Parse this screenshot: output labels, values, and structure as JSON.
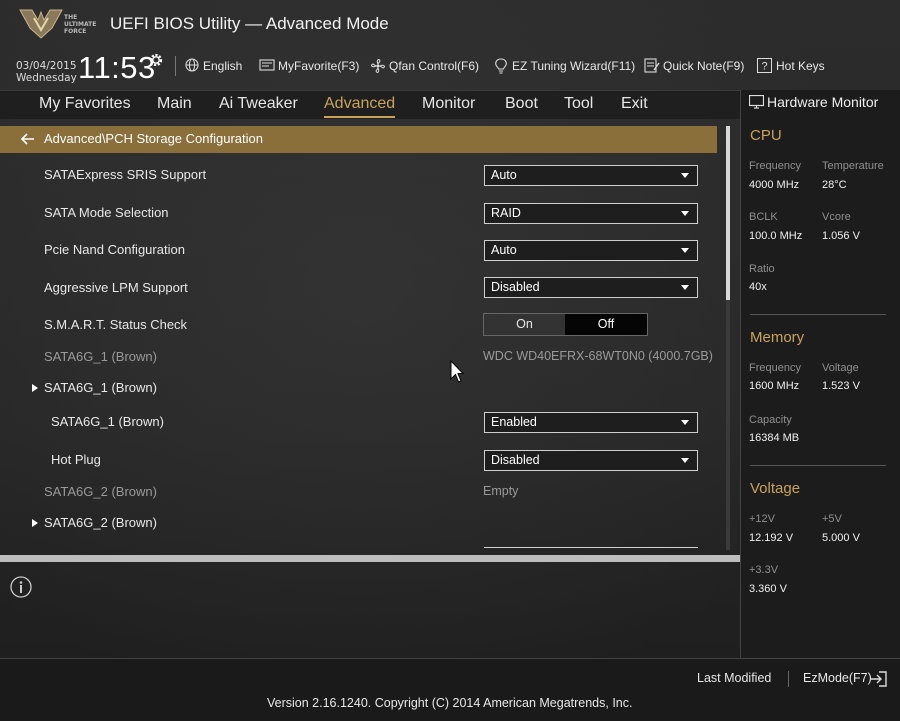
{
  "header": {
    "logo_text": "THE\nULTIMATE\nFORCE",
    "title": "UEFI BIOS Utility — Advanced Mode",
    "date": "03/04/2015",
    "day": "Wednesday",
    "time": "11:53",
    "toolbar": [
      {
        "label": "English",
        "icon": "globe-icon"
      },
      {
        "label": "MyFavorite(F3)",
        "icon": "favorite-icon"
      },
      {
        "label": "Qfan Control(F6)",
        "icon": "fan-icon"
      },
      {
        "label": "EZ Tuning Wizard(F11)",
        "icon": "bulb-icon"
      },
      {
        "label": "Quick Note(F9)",
        "icon": "note-icon"
      },
      {
        "label": "Hot Keys",
        "icon": "question-icon"
      }
    ]
  },
  "menu": {
    "tabs": [
      "My Favorites",
      "Main",
      "Ai Tweaker",
      "Advanced",
      "Monitor",
      "Boot",
      "Tool",
      "Exit"
    ],
    "active": "Advanced"
  },
  "breadcrumb": "Advanced\\PCH Storage Configuration",
  "settings": {
    "sataexpress_srис": {
      "label": "SATAExpress SRIS Support",
      "value": "Auto"
    },
    "sata_mode": {
      "label": "SATA Mode Selection",
      "value": "RAID"
    },
    "pcie_nand": {
      "label": "Pcie Nand Configuration",
      "value": "Auto"
    },
    "aggressive_lpm": {
      "label": "Aggressive LPM Support",
      "value": "Disabled"
    },
    "smart": {
      "label": "S.M.A.R.T. Status Check",
      "on": "On",
      "off": "Off",
      "selected": "Off"
    },
    "port1_info": {
      "label": "SATA6G_1 (Brown)",
      "value": "WDC WD40EFRX-68WT0N0 (4000.7GB)"
    },
    "port1_group": {
      "label": "SATA6G_1 (Brown)"
    },
    "port1_enable": {
      "label": "SATA6G_1 (Brown)",
      "value": "Enabled"
    },
    "port1_hotplug": {
      "label": "Hot Plug",
      "value": "Disabled"
    },
    "port2_info": {
      "label": "SATA6G_2 (Brown)",
      "value": "Empty"
    },
    "port2_group": {
      "label": "SATA6G_2 (Brown)"
    }
  },
  "hardware_monitor": {
    "title": "Hardware Monitor",
    "cpu": {
      "heading": "CPU",
      "frequency_label": "Frequency",
      "frequency": "4000 MHz",
      "temperature_label": "Temperature",
      "temperature": "28°C",
      "bclk_label": "BCLK",
      "bclk": "100.0 MHz",
      "vcore_label": "Vcore",
      "vcore": "1.056 V",
      "ratio_label": "Ratio",
      "ratio": "40x"
    },
    "memory": {
      "heading": "Memory",
      "frequency_label": "Frequency",
      "frequency": "1600 MHz",
      "voltage_label": "Voltage",
      "voltage": "1.523 V",
      "capacity_label": "Capacity",
      "capacity": "16384 MB"
    },
    "voltage": {
      "heading": "Voltage",
      "v12_label": "+12V",
      "v12": "12.192 V",
      "v5_label": "+5V",
      "v5": "5.000 V",
      "v33_label": "+3.3V",
      "v33": "3.360 V"
    }
  },
  "footer": {
    "last_modified": "Last Modified",
    "ezmode": "EzMode(F7)",
    "version": "Version 2.16.1240. Copyright (C) 2014 American Megatrends, Inc."
  },
  "colors": {
    "accent": "#c9a35a",
    "breadcrumb_bg": "#8a6f3a"
  }
}
